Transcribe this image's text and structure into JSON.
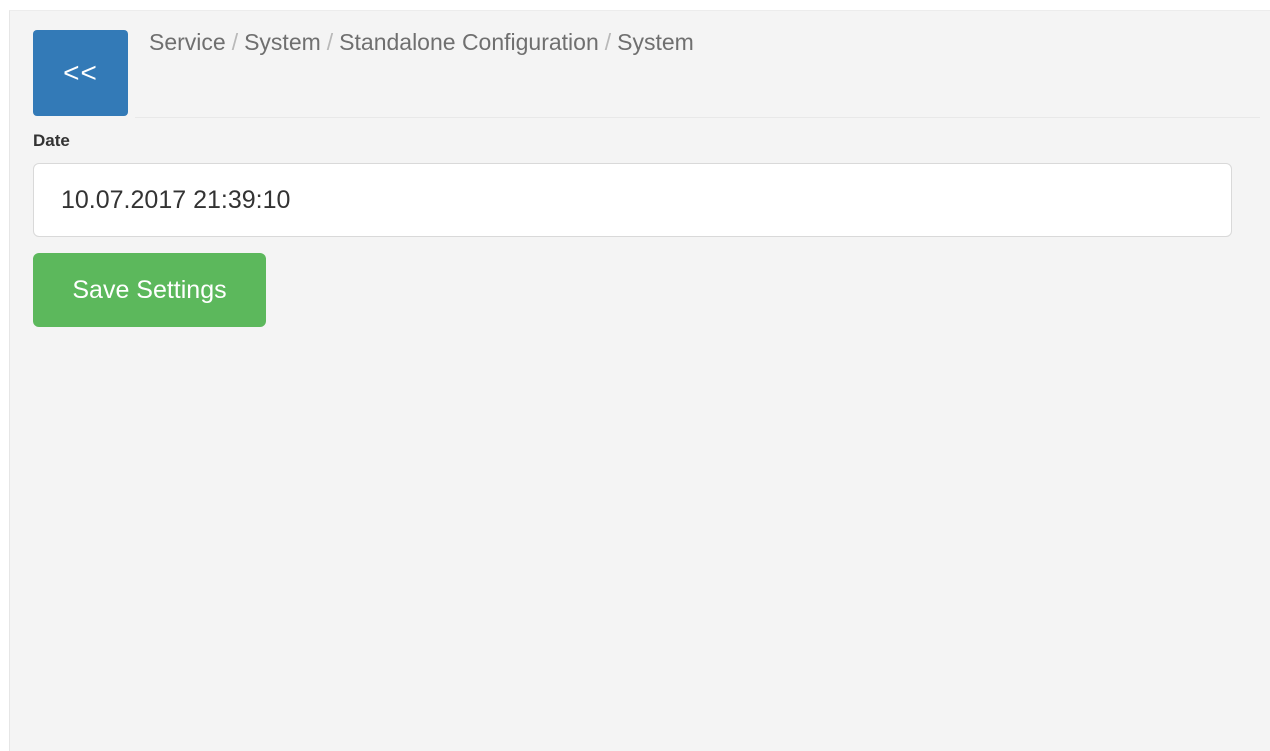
{
  "header": {
    "back_label": "<<",
    "breadcrumb": [
      "Service",
      "System",
      "Standalone Configuration",
      "System"
    ],
    "separator": "/"
  },
  "form": {
    "date_label": "Date",
    "date_value": "10.07.2017 21:39:10"
  },
  "actions": {
    "save_label": "Save Settings"
  },
  "colors": {
    "back_button": "#337ab7",
    "save_button": "#5cb85c",
    "panel_background": "#f4f4f4"
  }
}
